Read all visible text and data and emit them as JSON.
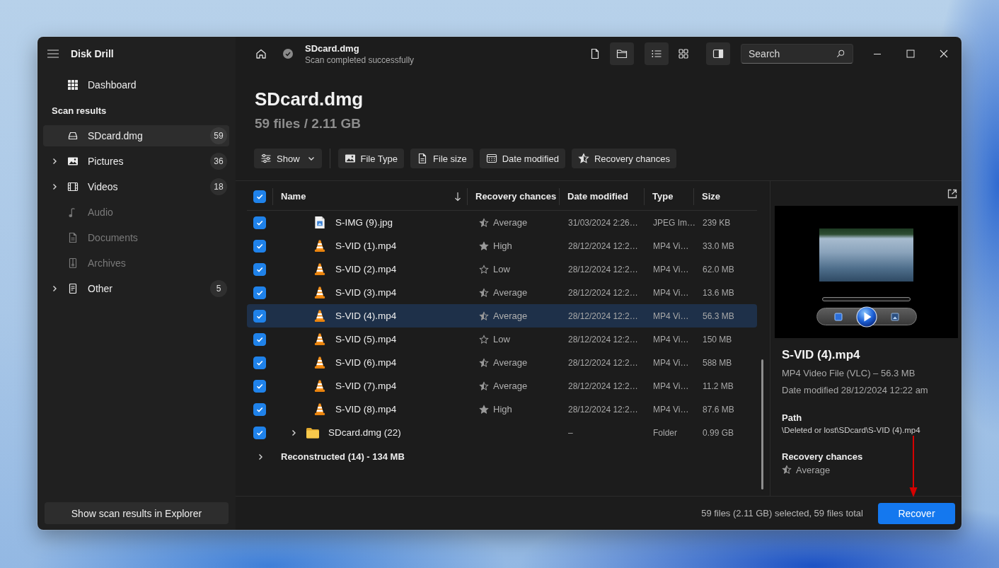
{
  "app": {
    "title": "Disk Drill"
  },
  "sidebar": {
    "nav": [
      {
        "label": "Dashboard",
        "selected": false
      }
    ],
    "section_title": "Scan results",
    "items": [
      {
        "label": "SDcard.dmg",
        "kind": "drive",
        "count": "59",
        "selected": true,
        "expandable": false,
        "disabled": false
      },
      {
        "label": "Pictures",
        "kind": "pictures",
        "count": "36",
        "selected": false,
        "expandable": true,
        "disabled": false
      },
      {
        "label": "Videos",
        "kind": "videos",
        "count": "18",
        "selected": false,
        "expandable": true,
        "disabled": false
      },
      {
        "label": "Audio",
        "kind": "audio",
        "selected": false,
        "expandable": false,
        "disabled": true
      },
      {
        "label": "Documents",
        "kind": "documents",
        "selected": false,
        "expandable": false,
        "disabled": true
      },
      {
        "label": "Archives",
        "kind": "archives",
        "selected": false,
        "expandable": false,
        "disabled": true
      },
      {
        "label": "Other",
        "kind": "other",
        "count": "5",
        "selected": false,
        "expandable": true,
        "disabled": false
      }
    ],
    "footer_button": "Show scan results in Explorer"
  },
  "topbar": {
    "title": "SDcard.dmg",
    "status": "Scan completed successfully",
    "view_buttons": [
      {
        "kind": "files",
        "selected": false
      },
      {
        "kind": "folders",
        "selected": true
      },
      {
        "kind": "list",
        "selected": true
      },
      {
        "kind": "grid",
        "selected": false
      },
      {
        "kind": "preview-pane",
        "selected": true
      }
    ],
    "search": {
      "placeholder": "Search"
    }
  },
  "header": {
    "title": "SDcard.dmg",
    "summary": "59 files / 2.11 GB"
  },
  "filters": [
    {
      "label": "Show",
      "kind": "dropdown"
    },
    {
      "label": "File Type",
      "kind": "picture"
    },
    {
      "label": "File size",
      "kind": "file"
    },
    {
      "label": "Date modified",
      "kind": "calendar"
    },
    {
      "label": "Recovery chances",
      "kind": "star"
    }
  ],
  "table": {
    "all_checked": true,
    "columns": [
      {
        "label": "Name",
        "sorted": true
      },
      {
        "label": "Recovery chances",
        "sorted": false
      },
      {
        "label": "Date modified",
        "sorted": false
      },
      {
        "label": "Type",
        "sorted": false
      },
      {
        "label": "Size",
        "sorted": false
      }
    ],
    "rows": [
      {
        "name": "S-IMG (9).jpg",
        "kind": "image",
        "checked": true,
        "selected": false,
        "recovery": {
          "text": "Average",
          "kind": "half"
        },
        "date": "31/03/2024 2:26…",
        "type": "JPEG Im…",
        "size": "239 KB"
      },
      {
        "name": "S-VID (1).mp4",
        "kind": "video",
        "checked": true,
        "selected": false,
        "recovery": {
          "text": "High",
          "kind": "full"
        },
        "date": "28/12/2024 12:2…",
        "type": "MP4 Vi…",
        "size": "33.0 MB"
      },
      {
        "name": "S-VID (2).mp4",
        "kind": "video",
        "checked": true,
        "selected": false,
        "recovery": {
          "text": "Low",
          "kind": "empty"
        },
        "date": "28/12/2024 12:2…",
        "type": "MP4 Vi…",
        "size": "62.0 MB"
      },
      {
        "name": "S-VID (3).mp4",
        "kind": "video",
        "checked": true,
        "selected": false,
        "recovery": {
          "text": "Average",
          "kind": "half"
        },
        "date": "28/12/2024 12:2…",
        "type": "MP4 Vi…",
        "size": "13.6 MB"
      },
      {
        "name": "S-VID (4).mp4",
        "kind": "video",
        "checked": true,
        "selected": true,
        "recovery": {
          "text": "Average",
          "kind": "half"
        },
        "date": "28/12/2024 12:2…",
        "type": "MP4 Vi…",
        "size": "56.3 MB"
      },
      {
        "name": "S-VID (5).mp4",
        "kind": "video",
        "checked": true,
        "selected": false,
        "recovery": {
          "text": "Low",
          "kind": "empty"
        },
        "date": "28/12/2024 12:2…",
        "type": "MP4 Vi…",
        "size": "150 MB"
      },
      {
        "name": "S-VID (6).mp4",
        "kind": "video",
        "checked": true,
        "selected": false,
        "recovery": {
          "text": "Average",
          "kind": "half"
        },
        "date": "28/12/2024 12:2…",
        "type": "MP4 Vi…",
        "size": "588 MB"
      },
      {
        "name": "S-VID (7).mp4",
        "kind": "video",
        "checked": true,
        "selected": false,
        "recovery": {
          "text": "Average",
          "kind": "half"
        },
        "date": "28/12/2024 12:2…",
        "type": "MP4 Vi…",
        "size": "11.2 MB"
      },
      {
        "name": "S-VID (8).mp4",
        "kind": "video",
        "checked": true,
        "selected": false,
        "recovery": {
          "text": "High",
          "kind": "full"
        },
        "date": "28/12/2024 12:2…",
        "type": "MP4 Vi…",
        "size": "87.6 MB"
      },
      {
        "name": "SDcard.dmg (22)",
        "kind": "folder",
        "checked": true,
        "selected": false,
        "expanded": false,
        "date": "–",
        "type": "Folder",
        "size": "0.99 GB"
      }
    ],
    "groups": [
      {
        "label": "Reconstructed (14) - 134 MB",
        "expanded": false
      }
    ]
  },
  "preview": {
    "file_name": "S-VID (4).mp4",
    "details": "MP4 Video File (VLC) – 56.3 MB",
    "date": "Date modified 28/12/2024 12:22 am",
    "path_label": "Path",
    "path": "\\Deleted or lost\\SDcard\\S-VID (4).mp4",
    "recovery_label": "Recovery chances",
    "recovery": {
      "text": "Average",
      "kind": "half"
    }
  },
  "footer": {
    "summary": "59 files (2.11 GB) selected, 59 files total",
    "button": "Recover"
  }
}
